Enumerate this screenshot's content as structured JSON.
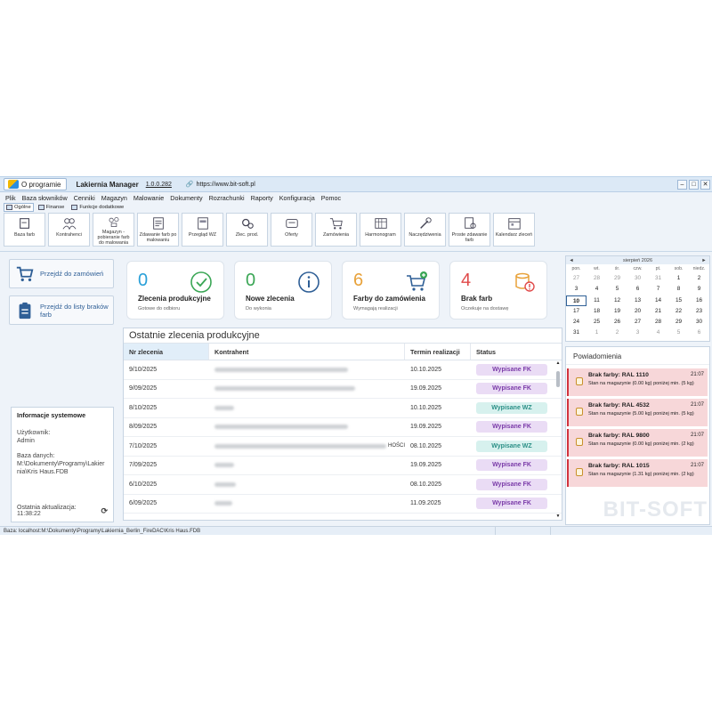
{
  "titlebar": {
    "about_label": "O programie",
    "app_name": "Lakiernia Manager",
    "version": "1.0.0.282",
    "url": "https://www.bit-soft.pl"
  },
  "menu": [
    "Plik",
    "Baza słowników",
    "Cenniki",
    "Magazyn",
    "Malowanie",
    "Dokumenty",
    "Rozrachunki",
    "Raporty",
    "Konfiguracja",
    "Pomoc"
  ],
  "ribbon_tabs": [
    "Ogólne",
    "Finanse",
    "Funkcje dodatkowe"
  ],
  "toolbar": [
    {
      "label": "Baza farb",
      "icon": "paint-bucket-icon"
    },
    {
      "label": "Kontrahenci",
      "icon": "contacts-icon"
    },
    {
      "label": "Magazyn - pobieranie farb do malowania",
      "icon": "warehouse-icon"
    },
    {
      "label": "Zdawanie farb po malowaniu",
      "icon": "return-paint-icon"
    },
    {
      "label": "Przegląd WZ",
      "icon": "document-icon"
    },
    {
      "label": "Zlec. prod.",
      "icon": "gears-icon"
    },
    {
      "label": "Oferty",
      "icon": "offer-icon"
    },
    {
      "label": "Zamówienia",
      "icon": "cart-icon"
    },
    {
      "label": "Harmonogram",
      "icon": "schedule-icon"
    },
    {
      "label": "Naczędziwenia",
      "icon": "tools-icon"
    },
    {
      "label": "Proste zdawanie farb",
      "icon": "simple-return-icon"
    },
    {
      "label": "Kalendarz zleceń",
      "icon": "calendar-icon"
    }
  ],
  "left": {
    "btn_orders": "Przejdź do zamówień",
    "btn_defects": "Przejdź do listy braków farb",
    "info_title": "Informacje systemowe",
    "user_label": "Użytkownik:",
    "user_value": "Admin",
    "db_label": "Baza danych:",
    "db_value": "M:\\Dokumenty\\Programy\\Lakiernia\\Kris Haus.FDB",
    "last_update": "Ostatnia aktualizacja: 11:38:22"
  },
  "cards": [
    {
      "value": "0",
      "title": "Zlecenia produkcyjne",
      "sub": "Gotowe do odbioru",
      "color": "#2aa0d8",
      "icon": "check-circle-icon"
    },
    {
      "value": "0",
      "title": "Nowe zlecenia",
      "sub": "Do wykonia",
      "color": "#3aa655",
      "icon": "info-circle-icon"
    },
    {
      "value": "6",
      "title": "Farby do zamówienia",
      "sub": "Wymagają realizacji",
      "color": "#e8a23a",
      "icon": "cart-plus-icon"
    },
    {
      "value": "4",
      "title": "Brak farb",
      "sub": "Oczekuje na dostawę",
      "color": "#e04a4a",
      "icon": "paint-can-warning-icon"
    }
  ],
  "table": {
    "title": "Ostatnie zlecenia produkcyjne",
    "headers": [
      "Nr zlecenia",
      "Kontrahent",
      "Termin realizacji",
      "Status"
    ],
    "rows": [
      {
        "nr": "9/10/2025",
        "date": "10.10.2025",
        "status": "Wypisane FK",
        "kind": "fk",
        "w": 150,
        "tail": ""
      },
      {
        "nr": "9/09/2025",
        "date": "19.09.2025",
        "status": "Wypisane FK",
        "kind": "fk",
        "w": 158,
        "tail": ""
      },
      {
        "nr": "8/10/2025",
        "date": "10.10.2025",
        "status": "Wypisane WZ",
        "kind": "wz",
        "w": 22,
        "tail": ""
      },
      {
        "nr": "8/09/2025",
        "date": "19.09.2025",
        "status": "Wypisane FK",
        "kind": "fk",
        "w": 150,
        "tail": ""
      },
      {
        "nr": "7/10/2025",
        "date": "08.10.2025",
        "status": "Wypisane WZ",
        "kind": "wz",
        "w": 198,
        "tail": "HOŚCI"
      },
      {
        "nr": "7/09/2025",
        "date": "19.09.2025",
        "status": "Wypisane FK",
        "kind": "fk",
        "w": 22,
        "tail": ""
      },
      {
        "nr": "6/10/2025",
        "date": "08.10.2025",
        "status": "Wypisane FK",
        "kind": "fk",
        "w": 24,
        "tail": ""
      },
      {
        "nr": "6/09/2025",
        "date": "11.09.2025",
        "status": "Wypisane FK",
        "kind": "fk",
        "w": 20,
        "tail": ""
      }
    ]
  },
  "calendar": {
    "month": "sierpień 2026",
    "prev": "◄",
    "next": "►",
    "day_names": [
      "pon.",
      "wt.",
      "śr.",
      "czw.",
      "pt.",
      "sob.",
      "niedz."
    ],
    "weeks": [
      [
        [
          "27",
          1
        ],
        [
          "28",
          1
        ],
        [
          "29",
          1
        ],
        [
          "30",
          1
        ],
        [
          "31",
          1
        ],
        [
          "1",
          0
        ],
        [
          "2",
          0
        ]
      ],
      [
        [
          "3",
          0
        ],
        [
          "4",
          0
        ],
        [
          "5",
          0
        ],
        [
          "6",
          0
        ],
        [
          "7",
          0
        ],
        [
          "8",
          0
        ],
        [
          "9",
          0
        ]
      ],
      [
        [
          "10",
          2
        ],
        [
          "11",
          0
        ],
        [
          "12",
          0
        ],
        [
          "13",
          0
        ],
        [
          "14",
          0
        ],
        [
          "15",
          0
        ],
        [
          "16",
          0
        ]
      ],
      [
        [
          "17",
          0
        ],
        [
          "18",
          0
        ],
        [
          "19",
          0
        ],
        [
          "20",
          0
        ],
        [
          "21",
          0
        ],
        [
          "22",
          0
        ],
        [
          "23",
          0
        ]
      ],
      [
        [
          "24",
          0
        ],
        [
          "25",
          0
        ],
        [
          "26",
          0
        ],
        [
          "27",
          0
        ],
        [
          "28",
          0
        ],
        [
          "29",
          0
        ],
        [
          "30",
          0
        ]
      ],
      [
        [
          "31",
          0
        ],
        [
          "1",
          1
        ],
        [
          "2",
          1
        ],
        [
          "3",
          1
        ],
        [
          "4",
          1
        ],
        [
          "5",
          1
        ],
        [
          "6",
          1
        ]
      ]
    ]
  },
  "notifications": {
    "title": "Powiadomienia",
    "items": [
      {
        "title": "Brak farby: RAL 1110",
        "time": "21:07",
        "desc": "Stan na magazynie (0.00 kg) poniżej min. (5 kg)"
      },
      {
        "title": "Brak farby: RAL 4532",
        "time": "21:07",
        "desc": "Stan na magazynie (5.00 kg) poniżej min. (5 kg)"
      },
      {
        "title": "Brak farby: RAL 9800",
        "time": "21:07",
        "desc": "Stan na magazynie (0.00 kg) poniżej min. (2 kg)"
      },
      {
        "title": "Brak farby: RAL 1015",
        "time": "21:07",
        "desc": "Stan na magazynie (1.31 kg) poniżej min. (2 kg)"
      }
    ]
  },
  "watermark": "BIT-SOFT",
  "statusbar": "Baza: localhost:M:\\Dokumenty\\Programy\\Lakiernia_Berlin_FireDAC\\Kris Haus.FDB"
}
